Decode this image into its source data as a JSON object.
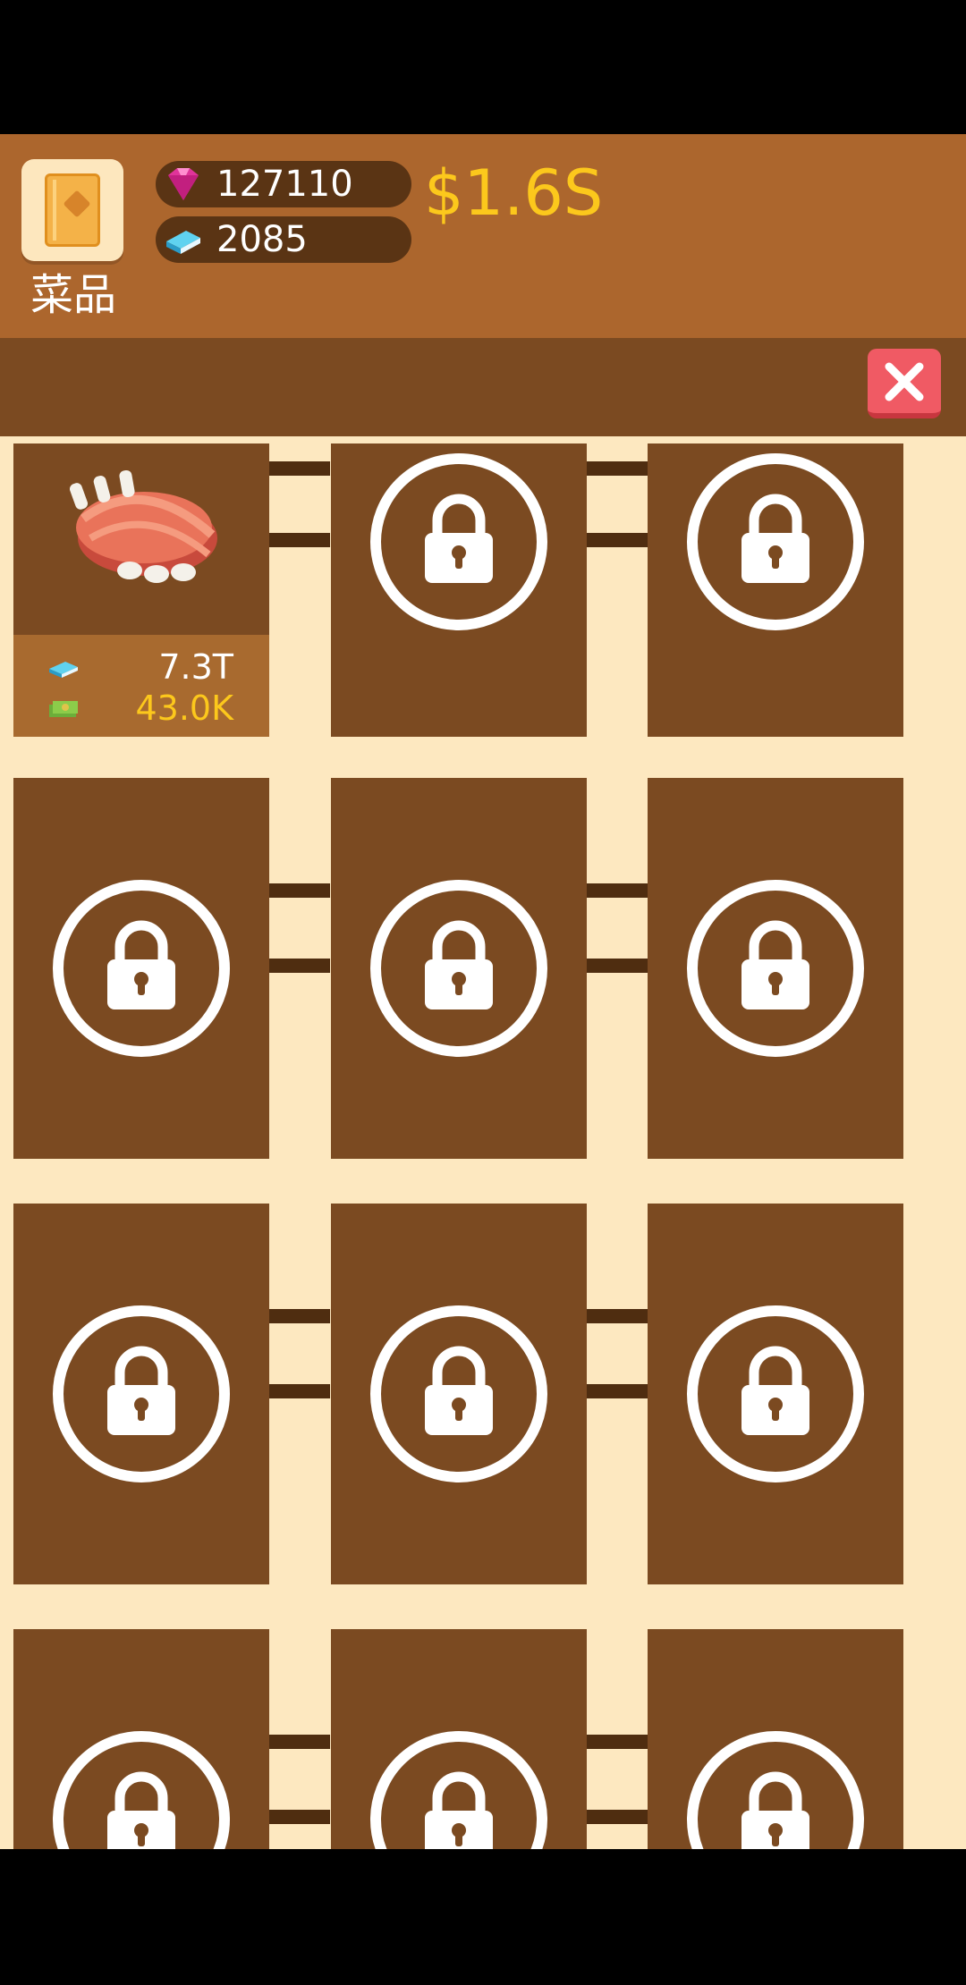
{
  "header": {
    "recipe_label": "菜品",
    "gems": "127110",
    "books": "2085",
    "money": "$1.6S"
  },
  "first_item": {
    "book_value": "7.3T",
    "cash_value": "43.0K"
  },
  "colors": {
    "header_bg": "#ac662d",
    "cell_bg": "#7b4a21",
    "grid_bg": "#fde8c0",
    "money": "#fcc81c",
    "close": "#f05a64"
  },
  "icons": {
    "recipe_book": "book-icon",
    "gem": "pink-gem-icon",
    "book": "blue-book-icon",
    "close": "close-icon",
    "lock": "padlock-icon",
    "cash": "cash-icon"
  }
}
